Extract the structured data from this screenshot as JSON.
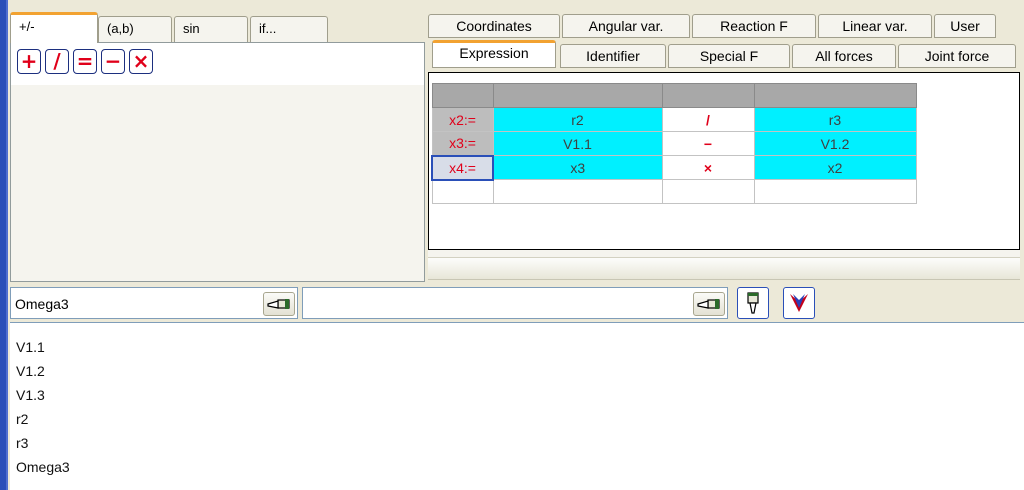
{
  "left_tabs": [
    "+/-",
    "(a,b)",
    "sin",
    "if..."
  ],
  "operators": [
    "+",
    "/",
    "=",
    "−",
    "×"
  ],
  "right_tabs_row1": [
    "Coordinates",
    "Angular var.",
    "Reaction F",
    "Linear var.",
    "User"
  ],
  "right_tabs_row2": [
    "Expression",
    "Identifier",
    "Special F",
    "All forces",
    "Joint force"
  ],
  "expressions": [
    {
      "label": "x2:=",
      "left": "r2",
      "op": "/",
      "right": "r3"
    },
    {
      "label": "x3:=",
      "left": "V1.1",
      "op": "−",
      "right": "V1.2"
    },
    {
      "label": "x4:=",
      "left": "x3",
      "op": "×",
      "right": "x2"
    }
  ],
  "input": {
    "name_value": "Omega3",
    "expression_value": ""
  },
  "list_items": [
    "V1.1",
    "V1.2",
    "V1.3",
    "r2",
    "r3",
    "Omega3"
  ],
  "icons": {
    "pick_left": "pointing-hand-icon",
    "pick_right": "pointing-hand-icon",
    "hand_down": "hand-down-icon",
    "check": "check-arrow-icon"
  },
  "colors": {
    "accent_tab": "#f2a231",
    "operator_red": "#e0001a",
    "cell_cyan": "#00f0ff",
    "frame_blue": "#2a4fb8"
  }
}
